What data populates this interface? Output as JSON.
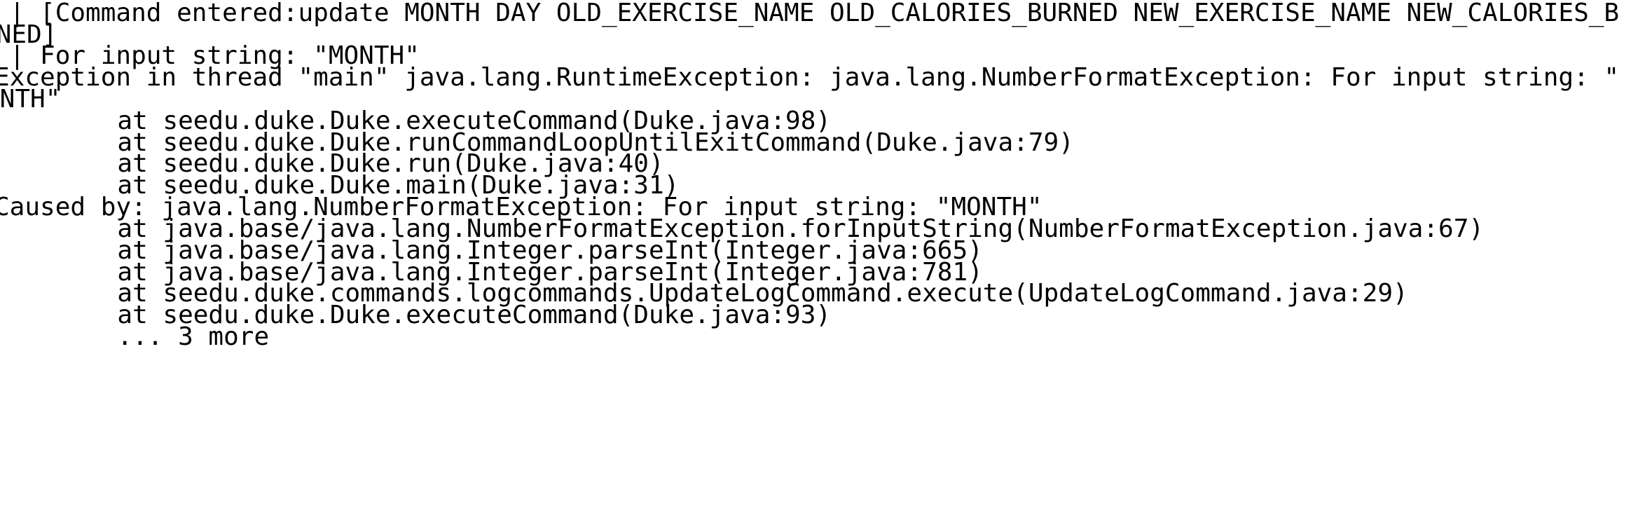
{
  "terminal": {
    "lines": [
      " | [Command entered:update MONTH DAY OLD_EXERCISE_NAME OLD_CALORIES_BURNED NEW_EXERCISE_NAME NEW_CALORIES_B",
      "RNED]",
      " | For input string: \"MONTH\"",
      "Exception in thread \"main\" java.lang.RuntimeException: java.lang.NumberFormatException: For input string: \"",
      "ONTH\"",
      "        at seedu.duke.Duke.executeCommand(Duke.java:98)",
      "        at seedu.duke.Duke.runCommandLoopUntilExitCommand(Duke.java:79)",
      "        at seedu.duke.Duke.run(Duke.java:40)",
      "        at seedu.duke.Duke.main(Duke.java:31)",
      "Caused by: java.lang.NumberFormatException: For input string: \"MONTH\"",
      "        at java.base/java.lang.NumberFormatException.forInputString(NumberFormatException.java:67)",
      "        at java.base/java.lang.Integer.parseInt(Integer.java:665)",
      "        at java.base/java.lang.Integer.parseInt(Integer.java:781)",
      "        at seedu.duke.commands.logcommands.UpdateLogCommand.execute(UpdateLogCommand.java:29)",
      "        at seedu.duke.Duke.executeCommand(Duke.java:93)",
      "        ... 3 more"
    ]
  }
}
